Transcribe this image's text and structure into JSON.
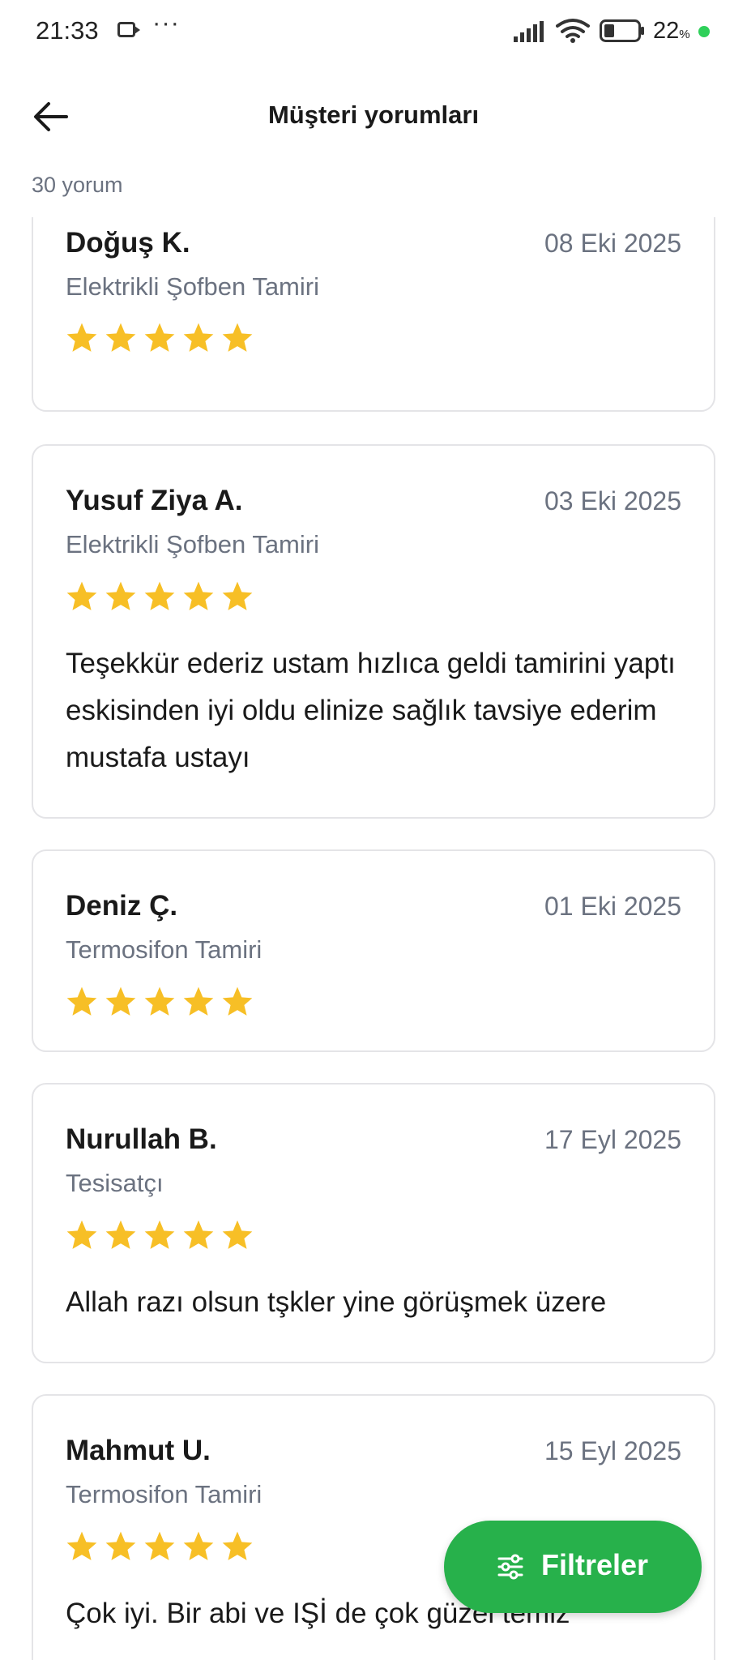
{
  "status_bar": {
    "time": "21:33",
    "dots": "···",
    "battery_percent": "22",
    "battery_unit": "%",
    "icons": [
      "camera-icon",
      "signal-icon",
      "wifi-icon",
      "battery-icon"
    ]
  },
  "header": {
    "back_icon": "arrow-left-icon",
    "title": "Müşteri yorumları"
  },
  "summary": {
    "count_label": "30 yorum"
  },
  "colors": {
    "star": "#f7bf26",
    "accent_green": "#27b14b",
    "muted_text": "#6b7280",
    "card_border": "#e4e4e7"
  },
  "reviews": [
    {
      "name": "Doğuş K.",
      "date": "08 Eki 2025",
      "service": "Elektrikli Şofben Tamiri",
      "rating": 5,
      "text": ""
    },
    {
      "name": "Yusuf Ziya A.",
      "date": "03 Eki 2025",
      "service": "Elektrikli Şofben Tamiri",
      "rating": 5,
      "text": "Teşekkür ederiz ustam hızlıca geldi tamirini yaptı eskisinden iyi oldu elinize sağlık tavsiye ederim mustafa ustayı"
    },
    {
      "name": "Deniz Ç.",
      "date": "01 Eki 2025",
      "service": "Termosifon Tamiri",
      "rating": 5,
      "text": ""
    },
    {
      "name": "Nurullah B.",
      "date": "17 Eyl 2025",
      "service": "Tesisatçı",
      "rating": 5,
      "text": "Allah razı olsun tşkler yine görüşmek üzere"
    },
    {
      "name": "Mahmut U.",
      "date": "15 Eyl 2025",
      "service": "Termosifon Tamiri",
      "rating": 5,
      "text": "Çok iyi. Bir abi ve IŞİ de çok güzel temiz"
    }
  ],
  "filter_button": {
    "icon": "sliders-icon",
    "label": "Filtreler"
  }
}
